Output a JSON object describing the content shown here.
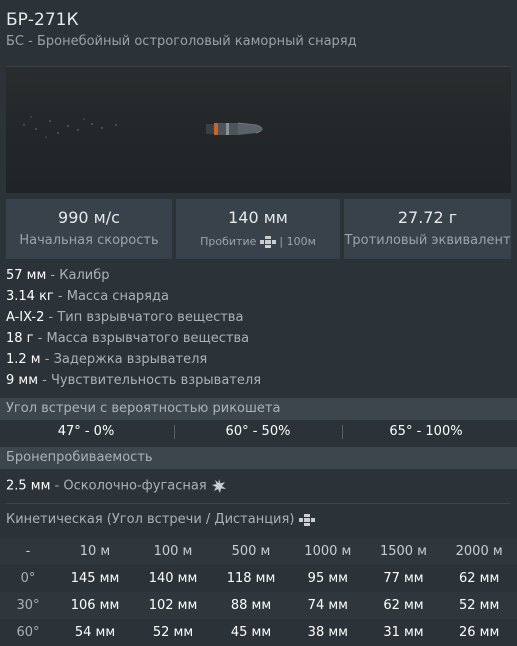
{
  "header": {
    "title": "БР-271К",
    "subtitle": "БС - Бронебойный остроголовый каморный снаряд"
  },
  "stats": [
    {
      "value": "990 м/с",
      "label": "Начальная скорость"
    },
    {
      "value": "140 мм",
      "label_prefix": "Пробитие",
      "label_suffix": "| 100м"
    },
    {
      "value": "27.72 г",
      "label": "Тротиловый эквивалент"
    }
  ],
  "properties": [
    {
      "value": "57 мм",
      "label": " - Калибр"
    },
    {
      "value": "3.14 кг",
      "label": " - Масса снаряда"
    },
    {
      "value": "A-IX-2",
      "label": " - Тип взрывчатого вещества"
    },
    {
      "value": "18 г",
      "label": " - Масса взрывчатого вещества"
    },
    {
      "value": "1.2 м",
      "label": " - Задержка взрывателя"
    },
    {
      "value": "9 мм",
      "label": " - Чувствительность взрывателя"
    }
  ],
  "ricochet": {
    "header": "Угол встречи с вероятностью рикошета",
    "items": [
      "47° - 0%",
      "60° - 50%",
      "65° - 100%"
    ]
  },
  "penetration": {
    "header": "Бронепробиваемость",
    "he_value": "2.5 мм",
    "he_label": " - Осколочно-фугасная",
    "kinetic_label": "Кинетическая (Угол встречи / Дистанция)",
    "columns": [
      "-",
      "10 м",
      "100 м",
      "500 м",
      "1000 м",
      "1500 м",
      "2000 м"
    ],
    "rows": [
      {
        "angle": "0°",
        "values": [
          "145 мм",
          "140 мм",
          "118 мм",
          "95 мм",
          "77 мм",
          "62 мм"
        ]
      },
      {
        "angle": "30°",
        "values": [
          "106 мм",
          "102 мм",
          "88 мм",
          "74 мм",
          "62 мм",
          "52 мм"
        ]
      },
      {
        "angle": "60°",
        "values": [
          "54 мм",
          "52 мм",
          "45 мм",
          "38 мм",
          "31 мм",
          "26 мм"
        ]
      }
    ]
  },
  "icons": {
    "penetration_icon": "crosshair-armor-icon",
    "he_icon": "explosion-icon",
    "kinetic_icon": "crosshair-armor-icon"
  }
}
